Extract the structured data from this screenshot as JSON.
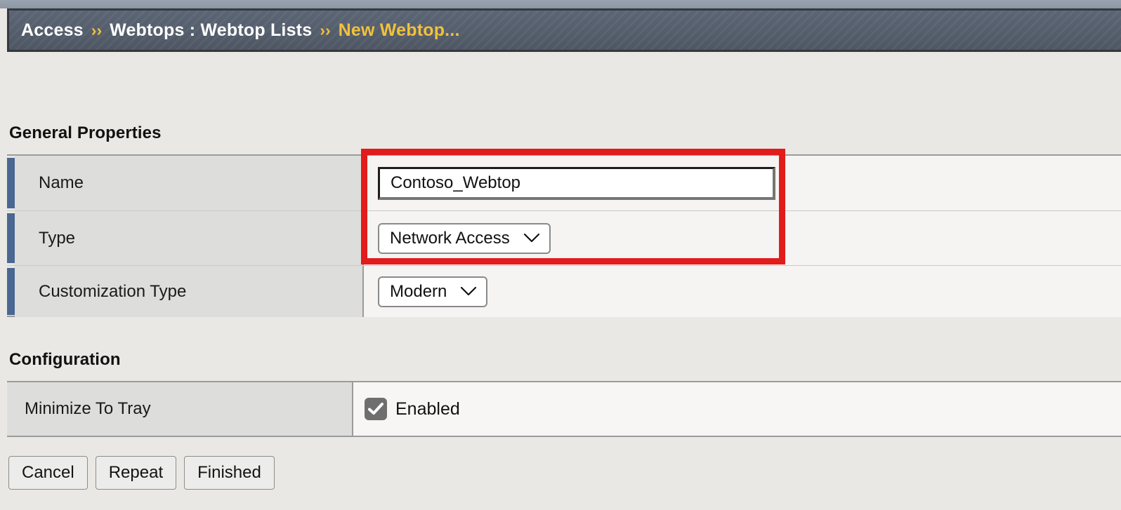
{
  "breadcrumb": {
    "root": "Access",
    "separator": "››",
    "section": "Webtops : Webtop Lists",
    "current": "New Webtop..."
  },
  "sections": {
    "general": {
      "title": "General Properties",
      "rows": [
        {
          "label": "Name",
          "control": "text-input",
          "value": "Contoso_Webtop"
        },
        {
          "label": "Type",
          "control": "dropdown",
          "value": "Network Access"
        },
        {
          "label": "Customization Type",
          "control": "dropdown",
          "value": "Modern"
        }
      ]
    },
    "configuration": {
      "title": "Configuration",
      "rows": [
        {
          "label": "Minimize To Tray",
          "control": "checkbox",
          "checked": true,
          "state_label": "Enabled"
        }
      ]
    }
  },
  "buttons": [
    {
      "label": "Cancel"
    },
    {
      "label": "Repeat"
    },
    {
      "label": "Finished"
    }
  ],
  "annotation": {
    "color": "#e21b1b",
    "kind": "highlight-rectangle"
  },
  "colors": {
    "page_background": "#e9e8e4",
    "header_background": "#555e6c",
    "accent_bar": "#4a6792",
    "highlight_text": "#f2c13c",
    "label_cell": "#dddddb",
    "value_cell": "#f5f4f2",
    "checkbox_fill": "#6e6e6e"
  }
}
